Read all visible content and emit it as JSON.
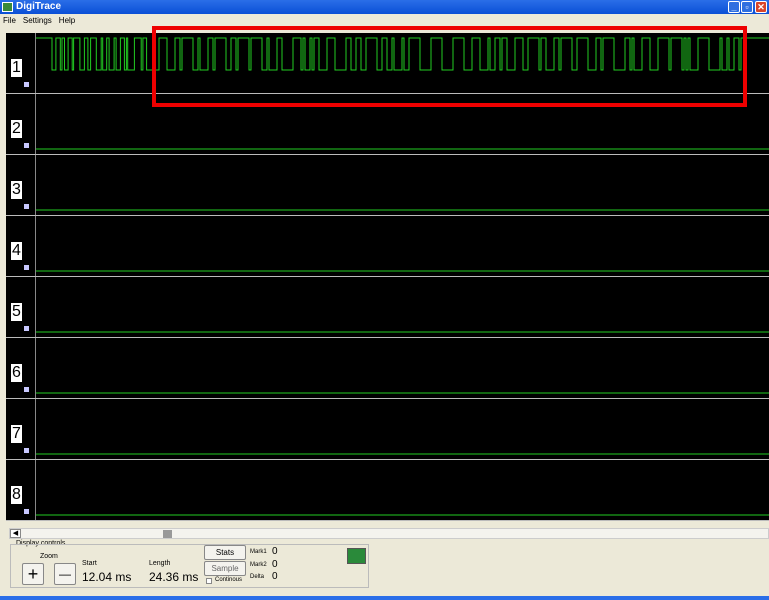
{
  "window": {
    "title": "DigiTrace"
  },
  "menu": [
    "File",
    "Settings",
    "Help"
  ],
  "channels": [
    {
      "label": "1",
      "active": true
    },
    {
      "label": "2"
    },
    {
      "label": "3"
    },
    {
      "label": "4"
    },
    {
      "label": "5"
    },
    {
      "label": "6"
    },
    {
      "label": "7"
    },
    {
      "label": "8"
    }
  ],
  "colors": {
    "trace": "#22cc22",
    "highlight": "#ee0000"
  },
  "controls": {
    "group": "Display controls",
    "zoom": "Zoom",
    "zoom_in": "+",
    "zoom_out": "—",
    "start_label": "Start",
    "start_value": "12.04 ms",
    "length_label": "Length",
    "length_value": "24.36 ms",
    "stats": "Stats",
    "sample": "Sample",
    "continuous": "Continous",
    "mark1_label": "Mark1",
    "mark1": "0",
    "mark2_label": "Mark2",
    "mark2": "0",
    "delta_label": "Delta",
    "delta": "0"
  }
}
